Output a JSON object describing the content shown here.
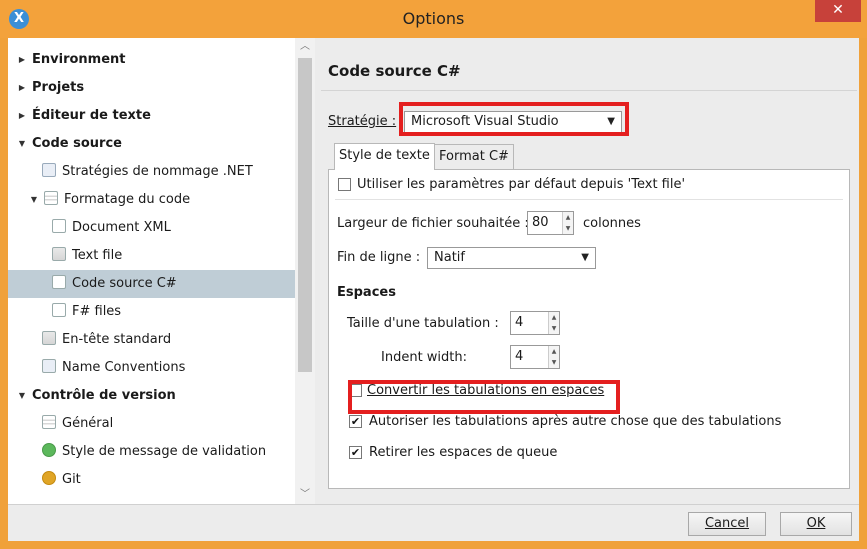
{
  "window": {
    "title": "Options",
    "close_glyph": "✕",
    "app_icon_glyph": "X",
    "accent_color": "#f3a23b"
  },
  "tree": {
    "items": [
      {
        "label": "Environment",
        "level": 0,
        "expanded": false,
        "bold": true,
        "icon": null
      },
      {
        "label": "Projets",
        "level": 0,
        "expanded": false,
        "bold": true,
        "icon": null
      },
      {
        "label": "Éditeur de texte",
        "level": 0,
        "expanded": false,
        "bold": true,
        "icon": null
      },
      {
        "label": "Code source",
        "level": 0,
        "expanded": true,
        "bold": true,
        "icon": null
      },
      {
        "label": "Stratégies de nommage .NET",
        "level": 1,
        "bold": false,
        "icon": "naming-icon"
      },
      {
        "label": "Formatage du code",
        "level": 1,
        "expanded": true,
        "bold": false,
        "icon": "formatting-icon"
      },
      {
        "label": "Document XML",
        "level": 2,
        "bold": false,
        "icon": "xml-file-icon"
      },
      {
        "label": "Text file",
        "level": 2,
        "bold": false,
        "icon": "text-file-icon"
      },
      {
        "label": "Code source C#",
        "level": 2,
        "bold": false,
        "icon": "csharp-file-icon",
        "selected": true
      },
      {
        "label": "F# files",
        "level": 2,
        "bold": false,
        "icon": "fsharp-file-icon"
      },
      {
        "label": "En-tête standard",
        "level": 1,
        "bold": false,
        "icon": "header-file-icon"
      },
      {
        "label": "Name Conventions",
        "level": 1,
        "bold": false,
        "icon": "name-conventions-icon"
      },
      {
        "label": "Contrôle de version",
        "level": 0,
        "expanded": true,
        "bold": true,
        "icon": null
      },
      {
        "label": "Général",
        "level": 1,
        "bold": false,
        "icon": "general-icon"
      },
      {
        "label": "Style de message de validation",
        "level": 1,
        "bold": false,
        "icon": "check-circle-icon"
      },
      {
        "label": "Git",
        "level": 1,
        "bold": false,
        "icon": "git-icon"
      }
    ]
  },
  "panel": {
    "title": "Code source C#",
    "strategy_label": "Stratégie :",
    "strategy_value": "Microsoft Visual Studio",
    "tabs": [
      {
        "label": "Style de texte",
        "active": true
      },
      {
        "label": "Format C#",
        "active": false
      }
    ],
    "use_defaults_label": "Utiliser les paramètres par défaut depuis 'Text file'",
    "use_defaults_checked": false,
    "file_width_label": "Largeur de fichier souhaitée :",
    "file_width_value": "80",
    "file_width_unit": "colonnes",
    "line_ending_label": "Fin de ligne :",
    "line_ending_value": "Natif",
    "spaces_section": "Espaces",
    "tab_size_label": "Taille d'une tabulation :",
    "tab_size_value": "4",
    "indent_width_label": "Indent width:",
    "indent_width_value": "4",
    "convert_tabs_label": "Convertir les tabulations en espaces",
    "convert_tabs_checked": false,
    "allow_tabs_label": "Autoriser les tabulations après autre chose que des tabulations",
    "allow_tabs_checked": true,
    "remove_trailing_label": "Retirer les espaces de queue",
    "remove_trailing_checked": true,
    "highlight_color": "#e41f1f"
  },
  "footer": {
    "cancel_label": "Cancel",
    "ok_label": "OK"
  }
}
